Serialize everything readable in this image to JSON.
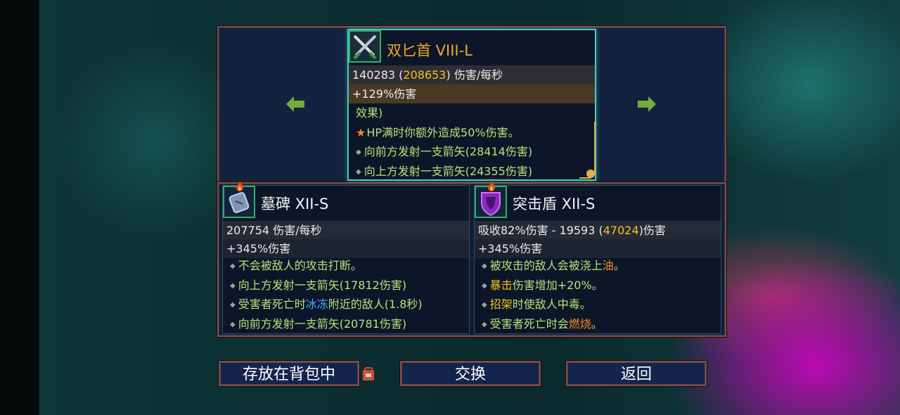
{
  "main_item": {
    "name": "双匕首 VIII-L",
    "dps_base": "140283 (",
    "dps_max": "208653",
    "dps_suffix": ") 伤害/每秒",
    "bonus": "+129%伤害",
    "effects_header": "效果)",
    "effects": [
      "HP满时你额外造成50%伤害。",
      "向前方发射一支箭矢(28414伤害)",
      "向上方发射一支箭矢(24355伤害)"
    ],
    "icon": "twin-daggers-icon"
  },
  "left_item": {
    "name": "墓碑 XII-S",
    "dps": "207754 伤害/每秒",
    "bonus": "+345%伤害",
    "effects": [
      {
        "parts": [
          "不会被敌人的攻击打断。"
        ]
      },
      {
        "parts": [
          "向上方发射一支箭矢(17812伤害)"
        ]
      },
      {
        "parts": [
          "受害者死亡时",
          "冰冻",
          "附近的敌人(1.8秒)"
        ]
      },
      {
        "parts": [
          "向前方发射一支箭矢(20781伤害)"
        ]
      }
    ],
    "icon": "tombstone-icon"
  },
  "right_item": {
    "name": "突击盾 XII-S",
    "dps_base": "吸收82%伤害 - 19593 (",
    "dps_max": "47024",
    "dps_suffix": ")伤害",
    "bonus": "+345%伤害",
    "effects": [
      {
        "parts": [
          "被攻击的敌人会被浇上",
          "油",
          "。"
        ]
      },
      {
        "parts": [
          "暴击",
          "伤害增加+20%。"
        ]
      },
      {
        "parts": [
          "招架",
          "时使敌人中毒。"
        ]
      },
      {
        "parts": [
          "受害者死亡时会",
          "燃烧",
          "。"
        ]
      }
    ],
    "icon": "assault-shield-icon"
  },
  "buttons": {
    "store": "存放在背包中",
    "swap": "交换",
    "back": "返回"
  },
  "colors": {
    "frame_border": "#8a4a3a",
    "rarity_gold": "#f0a82a",
    "effect_green": "#b8e07a",
    "highlight_yellow": "#f2c21d",
    "freeze_blue": "#4aa8ff",
    "fire_orange": "#ff8a2a"
  }
}
